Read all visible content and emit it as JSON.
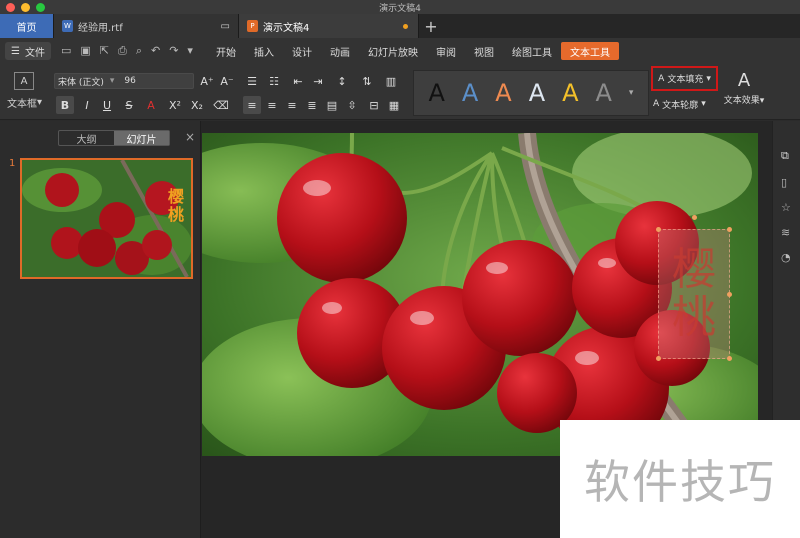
{
  "window": {
    "title": "演示文稿4",
    "traffic_colors": [
      "#fe5f57",
      "#febc2e",
      "#28c840"
    ]
  },
  "tabs": [
    {
      "label": "首页",
      "kind": "home"
    },
    {
      "label": "经验用.rtf",
      "kind": "doc",
      "icon": "word-doc-icon",
      "icon_color": "#3d6bb6"
    },
    {
      "label": "演示文稿4",
      "kind": "doc",
      "icon": "ppt-doc-icon",
      "icon_color": "#e06a28",
      "modified": true
    }
  ],
  "menubar": {
    "file_label": "文件",
    "items": [
      "开始",
      "插入",
      "设计",
      "动画",
      "幻灯片放映",
      "审阅",
      "视图",
      "绘图工具",
      "文本工具"
    ],
    "active_item": "文本工具"
  },
  "ribbon": {
    "textbox_label": "文本框",
    "font_name": "宋体 (正文)",
    "font_size": "96",
    "text_fill_label": "文本填充",
    "text_outline_label": "文本轮廓",
    "text_effect_label": "文本效果",
    "style_colors": [
      "#111111",
      "#5b8fc9",
      "#ee8a50",
      "#dde6f0",
      "#f3c02a",
      "#8c8c8c"
    ]
  },
  "left_panel": {
    "tab_outline": "大纲",
    "tab_slides": "幻灯片",
    "slide_number": "1"
  },
  "slide": {
    "vertical_text": [
      "樱",
      "桃"
    ],
    "thumb_text": [
      "樱",
      "桃"
    ]
  },
  "watermark": {
    "text": "软件技巧"
  },
  "accent": "#e66a2c"
}
